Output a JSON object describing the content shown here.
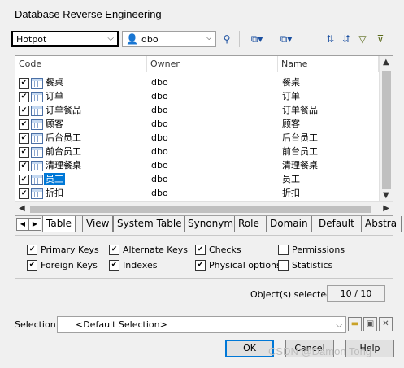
{
  "window": {
    "title": "Database Reverse Engineering"
  },
  "toolbar": {
    "dbms_value": "Hotpot",
    "owner_value": "dbo",
    "icons": [
      "user-filter-icon",
      "select-all-icon",
      "deselect-icon",
      "sort-asc-icon",
      "sort-desc-icon",
      "filter-icon",
      "clear-filter-icon"
    ]
  },
  "list": {
    "columns": [
      "Code",
      "Owner",
      "Name"
    ],
    "rows": [
      {
        "code": "餐桌",
        "owner": "dbo",
        "name": "餐桌",
        "checked": true,
        "selected": false
      },
      {
        "code": "订单",
        "owner": "dbo",
        "name": "订单",
        "checked": true,
        "selected": false
      },
      {
        "code": "订单餐品",
        "owner": "dbo",
        "name": "订单餐品",
        "checked": true,
        "selected": false
      },
      {
        "code": "顾客",
        "owner": "dbo",
        "name": "顾客",
        "checked": true,
        "selected": false
      },
      {
        "code": "后台员工",
        "owner": "dbo",
        "name": "后台员工",
        "checked": true,
        "selected": false
      },
      {
        "code": "前台员工",
        "owner": "dbo",
        "name": "前台员工",
        "checked": true,
        "selected": false
      },
      {
        "code": "清理餐桌",
        "owner": "dbo",
        "name": "清理餐桌",
        "checked": true,
        "selected": false
      },
      {
        "code": "员工",
        "owner": "dbo",
        "name": "员工",
        "checked": true,
        "selected": true
      },
      {
        "code": "折扣",
        "owner": "dbo",
        "name": "折扣",
        "checked": true,
        "selected": false
      }
    ]
  },
  "tabs": [
    "Table",
    "View",
    "System Table",
    "Synonym",
    "Role",
    "Domain",
    "Default",
    "Abstra"
  ],
  "active_tab": "Table",
  "options": [
    {
      "label": "Primary Keys",
      "checked": true
    },
    {
      "label": "Alternate Keys",
      "checked": true
    },
    {
      "label": "Checks",
      "checked": true
    },
    {
      "label": "Permissions",
      "checked": false
    },
    {
      "label": "Foreign Keys",
      "checked": true
    },
    {
      "label": "Indexes",
      "checked": true
    },
    {
      "label": "Physical options",
      "checked": true
    },
    {
      "label": "Statistics",
      "checked": false
    }
  ],
  "objects_selected": {
    "label": "Object(s) selected:",
    "value": "10 / 10"
  },
  "selection": {
    "label": "Selection:",
    "value": "<Default Selection>"
  },
  "buttons": {
    "ok": "OK",
    "cancel": "Cancel",
    "help": "Help"
  },
  "watermark": "CSDN @Damon Tong"
}
